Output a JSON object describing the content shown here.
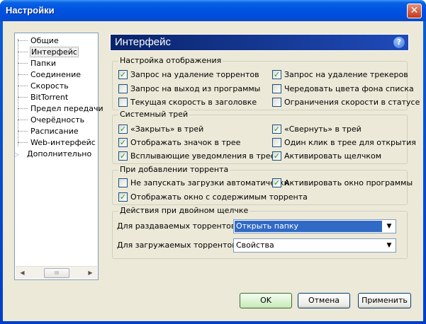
{
  "window": {
    "title": "Настройки"
  },
  "nav": {
    "items": [
      {
        "label": "Общие"
      },
      {
        "label": "Интерфейс"
      },
      {
        "label": "Папки"
      },
      {
        "label": "Соединение"
      },
      {
        "label": "Скорость"
      },
      {
        "label": "BitTorrent"
      },
      {
        "label": "Предел передачи"
      },
      {
        "label": "Очерёдность"
      },
      {
        "label": "Расписание"
      },
      {
        "label": "Web-интерфейс"
      },
      {
        "label": "Дополнительно"
      }
    ],
    "selected": "Интерфейс",
    "scroll_thumb_glyph": "III"
  },
  "panel": {
    "title": "Интерфейс",
    "help_glyph": "?",
    "display": {
      "legend": "Настройка отображения",
      "items": [
        {
          "label": "Запрос на удаление торрентов",
          "checked": true
        },
        {
          "label": "Запрос на удаление трекеров",
          "checked": true
        },
        {
          "label": "Запрос на выход из программы",
          "checked": false
        },
        {
          "label": "Чередовать цвета фона списка",
          "checked": false
        },
        {
          "label": "Текущая скорость в заголовке",
          "checked": false
        },
        {
          "label": "Ограничения скорости в статусе",
          "checked": false
        }
      ]
    },
    "tray": {
      "legend": "Системный трей",
      "items": [
        {
          "label": "«Закрыть» в трей",
          "checked": true
        },
        {
          "label": "«Свернуть» в трей",
          "checked": true
        },
        {
          "label": "Отображать значок в трее",
          "checked": true
        },
        {
          "label": "Один клик в трее для открытия",
          "checked": false
        },
        {
          "label": "Всплывающие уведомления в трее",
          "checked": true
        },
        {
          "label": "Активировать щелчком",
          "checked": true
        }
      ]
    },
    "add": {
      "legend": "При добавлении торрента",
      "items": [
        {
          "label": "Не запускать загрузки автоматически",
          "checked": false
        },
        {
          "label": "Активировать окно программы",
          "checked": true
        },
        {
          "label": "Отображать окно с содержимым торрента",
          "checked": true
        }
      ]
    },
    "dblclick": {
      "legend": "Действия при двойном щелчке",
      "seeding_label": "Для раздаваемых торрентов:",
      "seeding_value": "Открыть папку",
      "downloading_label": "Для загружаемых торрентов:",
      "downloading_value": "Свойства"
    }
  },
  "buttons": {
    "ok": "OK",
    "cancel": "Отмена",
    "apply": "Применить"
  },
  "colors": {
    "titlebar": "#0054e3",
    "header": "#0a246a",
    "selection": "#316ac5",
    "check": "#21a121"
  }
}
